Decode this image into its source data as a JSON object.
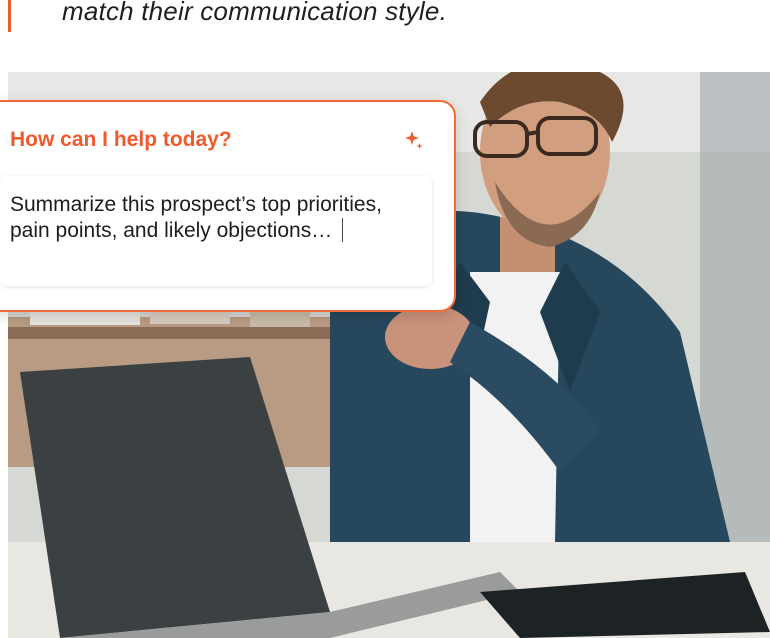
{
  "tagline": "match their communication style.",
  "prompt_card": {
    "header": "How can I help today?",
    "icon": "sparkle-icon",
    "input_text": "Summarize this prospect’s top priorities, pain points, and likely objections…"
  },
  "colors": {
    "accent": "#f05a2a",
    "text": "#1d1d1d",
    "card_bg": "#ffffff"
  }
}
